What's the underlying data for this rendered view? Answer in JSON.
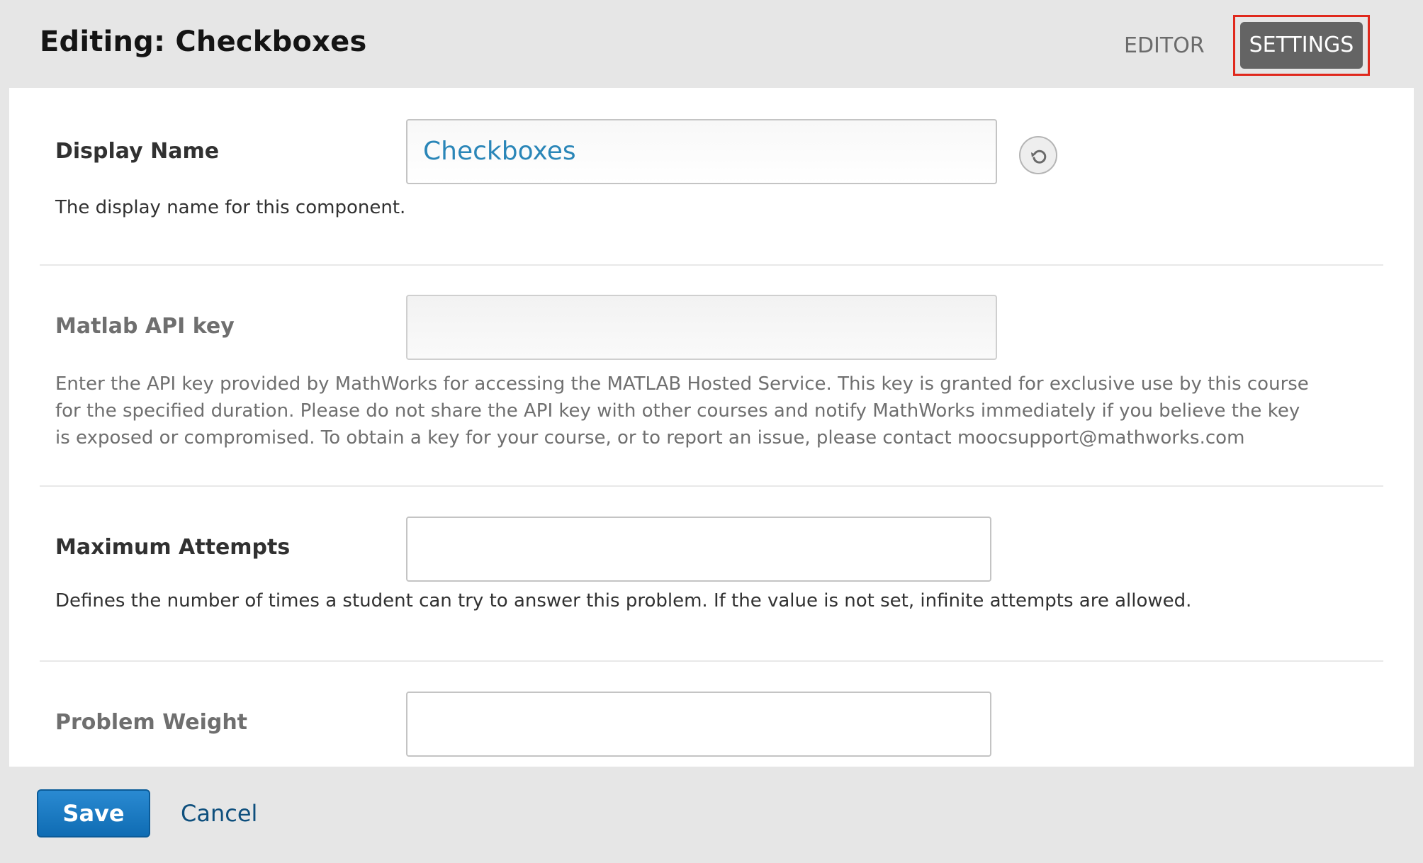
{
  "header": {
    "title": "Editing: Checkboxes",
    "tabs": {
      "editor": "EDITOR",
      "settings": "SETTINGS"
    },
    "active_tab": "SETTINGS",
    "highlight_color": "#e0281c"
  },
  "settings": {
    "display_name": {
      "label": "Display Name",
      "value": "Checkboxes",
      "help": "The display name for this component.",
      "reset_icon": "undo-icon"
    },
    "matlab_api_key": {
      "label": "Matlab API key",
      "value": "",
      "help": "Enter the API key provided by MathWorks for accessing the MATLAB Hosted Service. This key is granted for exclusive use by this course for the specified duration. Please do not share the API key with other courses and notify MathWorks immediately if you believe the key is exposed or compromised. To obtain a key for your course, or to report an issue, please contact moocsupport@mathworks.com"
    },
    "maximum_attempts": {
      "label": "Maximum Attempts",
      "value": "",
      "help": "Defines the number of times a student can try to answer this problem. If the value is not set, infinite attempts are allowed."
    },
    "problem_weight": {
      "label": "Problem Weight",
      "value": ""
    }
  },
  "footer": {
    "save_label": "Save",
    "cancel_label": "Cancel",
    "save_color": "#1a7bc4"
  }
}
